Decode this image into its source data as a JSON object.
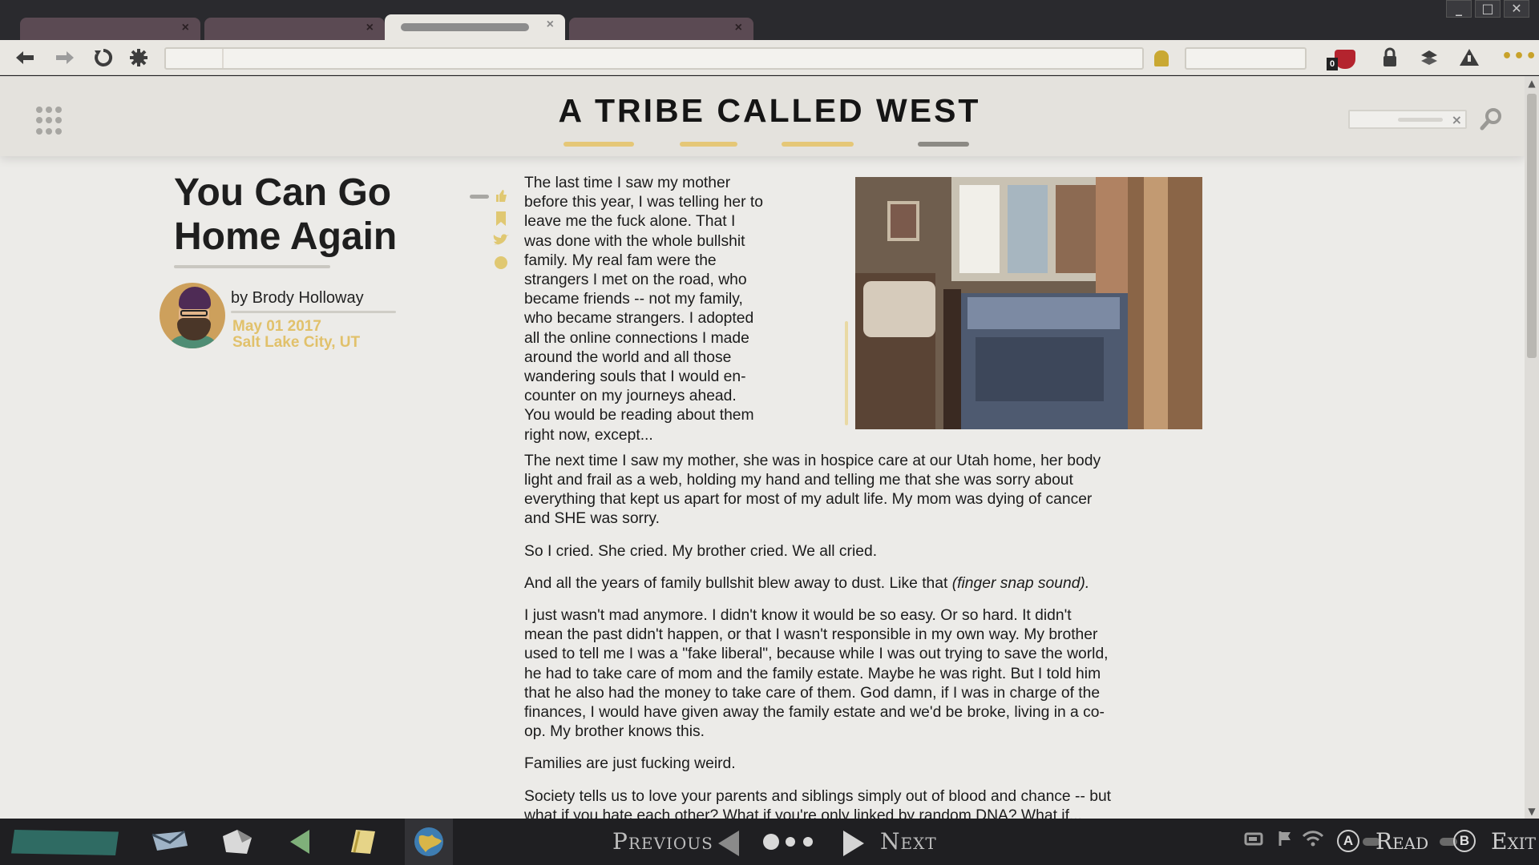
{
  "browser": {
    "tabs": [
      {
        "active": false,
        "close": "×"
      },
      {
        "active": false,
        "close": "×"
      },
      {
        "active": true,
        "close": "×"
      },
      {
        "active": false,
        "close": "×"
      }
    ],
    "window_controls": {
      "minimize": "_",
      "maximize": "□",
      "close": "✕"
    },
    "toolbar_icons": {
      "back": "arrow-left-icon",
      "forward": "arrow-right-icon",
      "reload": "reload-icon",
      "extensions": "puzzle-icon",
      "bookmark": "bookmark-icon",
      "shield": "shield-icon",
      "lock": "lock-icon",
      "sync": "sync-icon",
      "alert": "alert-icon",
      "menu": "more-icon"
    },
    "shield_badge": "0",
    "menu_glyph": "•••"
  },
  "site": {
    "title": "A TRIBE CALLED WEST",
    "search_clear": "×",
    "accent": "#e5c777"
  },
  "article": {
    "title": "You Can Go\nHome Again",
    "byline": "by Brody Holloway",
    "date": "May 01 2017",
    "location": "Salt Lake City, UT",
    "paragraphs": [
      "The last time I saw my mother before this year, I was telling her to leave me the fuck alone. That I was done with the whole bullshit family. My real fam were the strangers I met on the road, who became friends -- not my family, who became strangers. I adopted all the online connections I made around the world and all those wandering souls that I would en-counter on my journeys ahead. You would be reading about them right now, except...",
      "The next time I saw my mother, she was in hospice care at our Utah home, her body light and frail as a web, holding my hand and telling me that she was sorry about everything that kept us apart for most of my adult life. My mom was dying of cancer and SHE was sorry.",
      "So I cried. She cried. My brother cried. We all cried.",
      "I just wasn't mad anymore. I didn't know it would be so easy. Or so hard. It didn't mean the past didn't happen, or that I wasn't responsible in my own way. My brother used to tell me I was a \"fake liberal\", because while I was out trying to save the world, he had to take care of mom and the family estate. Maybe he was right. But I told him that he also had the money to take care of them. God damn, if I was in charge of the finances, I would have given away the family estate and we'd be broke, living in a co-op. My brother knows this.",
      "Families are just fucking weird.",
      "Society tells us to love your parents and siblings simply out of blood and chance -- but what if you hate each other? What if you're only linked by random DNA? What if..."
    ],
    "snap_paragraph": {
      "text": "And all the years of family bullshit blew away to dust. Like that ",
      "emphasis": "(finger snap sound)",
      "end": "."
    }
  },
  "taskbar": {
    "previous_label": "Previous",
    "next_label": "Next",
    "button_a": "A",
    "button_a_label": "Read",
    "button_b": "B",
    "button_b_label": "Exit"
  }
}
